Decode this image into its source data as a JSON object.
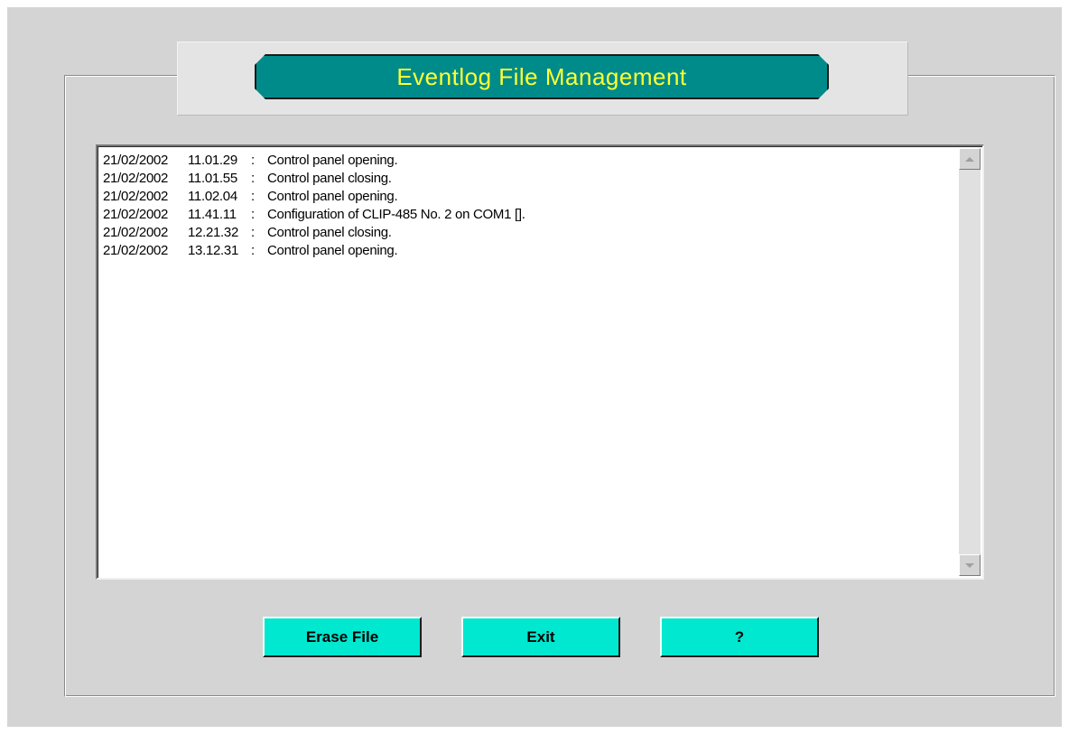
{
  "window": {
    "title": "Eventlog File Management"
  },
  "log": {
    "entries": [
      {
        "date": "21/02/2002",
        "time": "11.01.29",
        "message": "Control panel opening."
      },
      {
        "date": "21/02/2002",
        "time": "11.01.55",
        "message": "Control panel closing."
      },
      {
        "date": "21/02/2002",
        "time": "11.02.04",
        "message": "Control panel opening."
      },
      {
        "date": "21/02/2002",
        "time": "11.41.11",
        "message": "Configuration of CLIP-485 No. 2 on COM1  []."
      },
      {
        "date": "21/02/2002",
        "time": "12.21.32",
        "message": "Control panel closing."
      },
      {
        "date": "21/02/2002",
        "time": "13.12.31",
        "message": "Control panel opening."
      }
    ],
    "separator": ":"
  },
  "buttons": {
    "erase_label": "Erase File",
    "exit_label": "Exit",
    "help_label": "?"
  },
  "colors": {
    "title_plate": "#008b8b",
    "title_text": "#ffff33",
    "button_face": "#00e8d0",
    "window_bg": "#d4d4d4"
  },
  "icons": {
    "scroll_up": "arrow-up-icon",
    "scroll_down": "arrow-down-icon"
  }
}
